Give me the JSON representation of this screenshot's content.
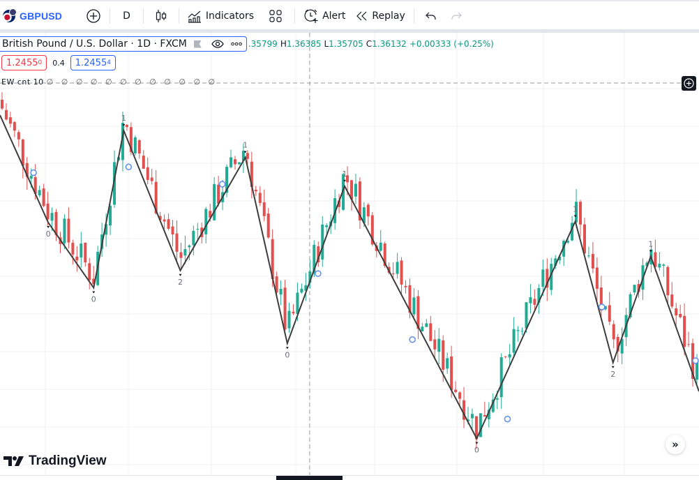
{
  "toolbar": {
    "symbol": "GBPUSD",
    "interval": "D",
    "indicators_label": "Indicators",
    "alert_label": "Alert",
    "replay_label": "Replay",
    "icons": [
      "flag-gbp-usd-icon",
      "add-symbol-icon",
      "candles-icon",
      "indicators-icon",
      "layouts-icon",
      "alarm-icon",
      "replay-icon",
      "undo-icon",
      "redo-icon"
    ]
  },
  "legend": {
    "title": "British Pound / U.S. Dollar · 1D · FXCM",
    "open_partial": ".35799",
    "high_key": "H",
    "high": "1.36385",
    "low_key": "L",
    "low": "1.35705",
    "close_key": "C",
    "close": "1.36132",
    "change": "+0.00333 (+0.25%)"
  },
  "trade": {
    "sell_price": "1.2455",
    "sell_sup": "0",
    "spread": "0.4",
    "buy_price": "1.2455",
    "buy_sup": "4"
  },
  "indicator": {
    "label": "EW cnt 10",
    "values": "∅ ∅ ∅ ∅ ∅ ∅ ∅ ∅ ∅ ∅ ∅ ∅"
  },
  "brand": {
    "name": "TradingView"
  },
  "colors": {
    "up": "#22ab94",
    "down": "#e0504f",
    "zigzag": "#3d3d3d",
    "accent": "#2962ff",
    "circle": "#5b8def"
  },
  "chart_data": {
    "type": "candlestick",
    "scale_note": "relative price level 0-100 (no price axis visible)",
    "ylim": [
      0,
      100
    ],
    "xlim": [
      0,
      100
    ],
    "grid": true,
    "zigzag": [
      {
        "x": 0,
        "y": 90,
        "label": ""
      },
      {
        "x": 6.9,
        "y": 62,
        "label": "0"
      },
      {
        "x": 13.4,
        "y": 45,
        "label": "0"
      },
      {
        "x": 17.7,
        "y": 86,
        "label": "1"
      },
      {
        "x": 25.8,
        "y": 49.5,
        "label": "2"
      },
      {
        "x": 35.1,
        "y": 79,
        "label": "1"
      },
      {
        "x": 41.1,
        "y": 30.5,
        "label": "0"
      },
      {
        "x": 49.3,
        "y": 71.5,
        "label": "1"
      },
      {
        "x": 68.2,
        "y": 5.7,
        "label": "0"
      },
      {
        "x": 82.3,
        "y": 62.3,
        "label": "1"
      },
      {
        "x": 87.7,
        "y": 25.5,
        "label": "2"
      },
      {
        "x": 93.1,
        "y": 53.2,
        "label": "1"
      },
      {
        "x": 100,
        "y": 18,
        "label": ""
      }
    ],
    "circles": [
      {
        "x": 4.8,
        "y": 75
      },
      {
        "x": 18.4,
        "y": 76.5
      },
      {
        "x": 31.8,
        "y": 72
      },
      {
        "x": 45.5,
        "y": 48.7
      },
      {
        "x": 59.0,
        "y": 31.5
      },
      {
        "x": 72.6,
        "y": 10.8
      },
      {
        "x": 86.1,
        "y": 40
      },
      {
        "x": 99.5,
        "y": 26
      }
    ],
    "crosshair_x": 44.3
  }
}
